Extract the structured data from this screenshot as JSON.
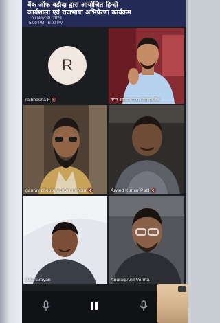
{
  "meeting": {
    "title_line1": "बैंक ऑफ बड़ौदा द्वारा आयोजित हिन्दी",
    "title_line2": "कार्यशाला एवं राजभाषा अभिप्रेरणा कार्यक्रम",
    "date": "Thu Nov 30, 2023",
    "time": "5:00 PM - 6:00 PM"
  },
  "participants": [
    {
      "name": "rajbhasha F",
      "avatar_letter": "R",
      "muted": true
    },
    {
      "name": "नमन अग्रवाल पंजाब नेशनल बैंक",
      "muted": false,
      "speaking": true
    },
    {
      "name": "gaurav choubey BOI fatehpur",
      "muted": true
    },
    {
      "name": "Arvind Kumar Patil",
      "muted": true
    },
    {
      "name": "Raj narayan",
      "muted": false
    },
    {
      "name": "Anurag Anil Verma",
      "muted": false
    }
  ],
  "icons": {
    "mute": "mic-off-icon",
    "controls": [
      "mic-icon",
      "pause-icon",
      "mic-icon"
    ],
    "self_view": "switch-camera-icon"
  },
  "colors": {
    "header_bg": "#232a55",
    "active_speaker_border": "#1f6fd8",
    "stage_bg": "#1c1d21"
  }
}
